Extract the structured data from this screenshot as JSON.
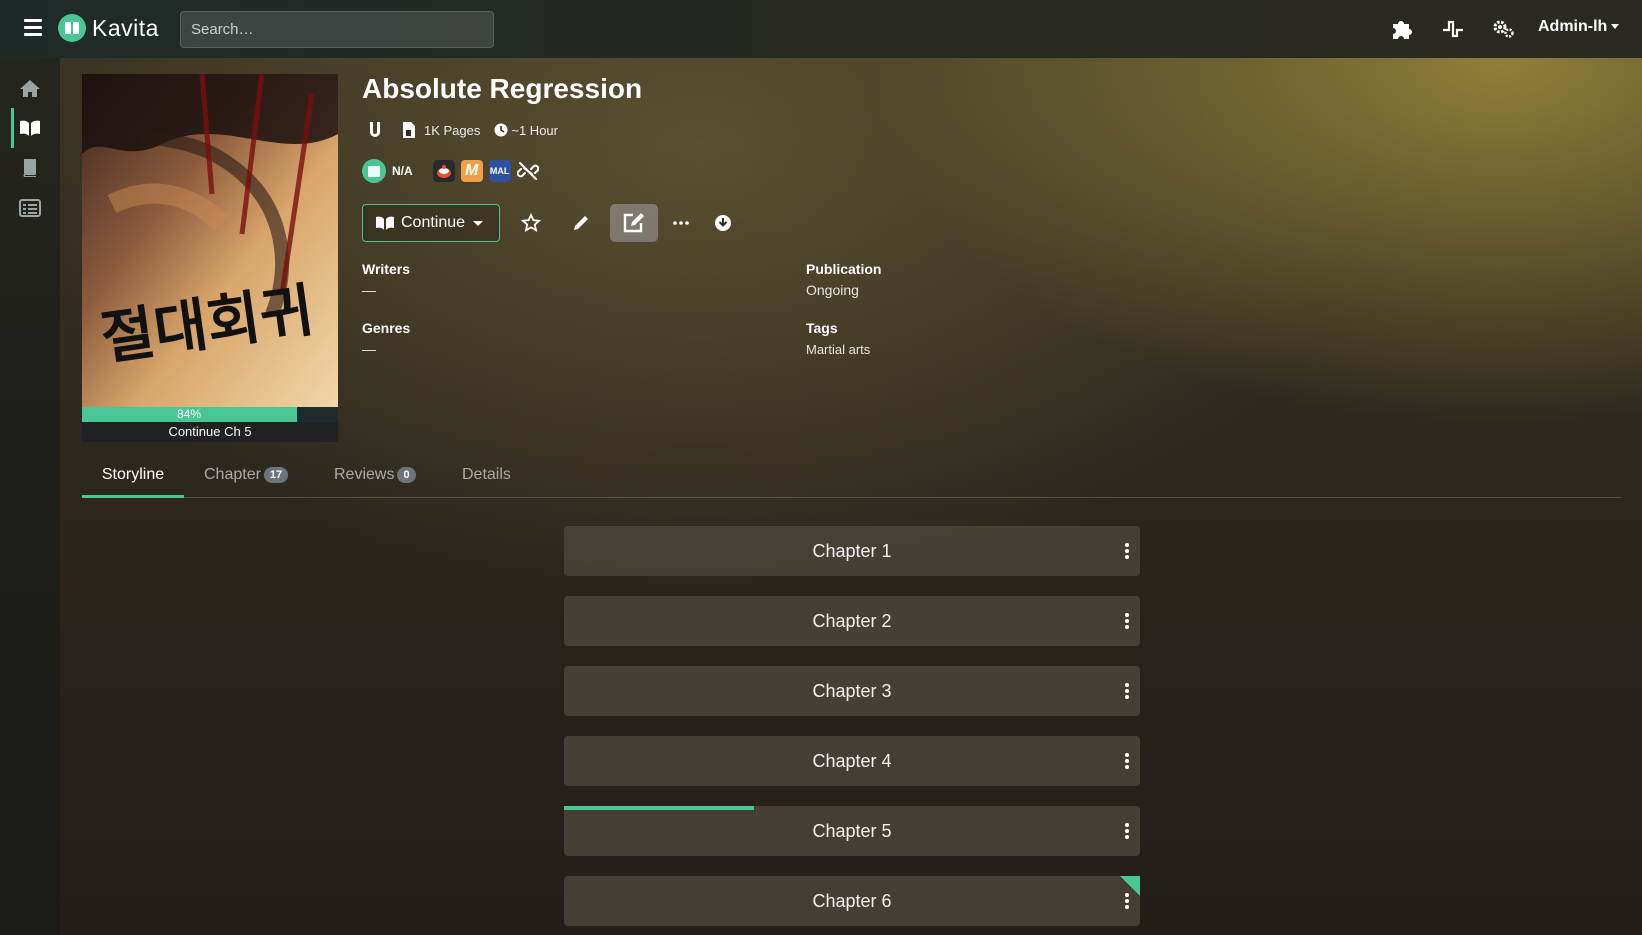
{
  "app": {
    "name": "Kavita",
    "brand_color": "#4ac694"
  },
  "navbar": {
    "search_placeholder": "Search…",
    "icons": [
      "menu-icon",
      "puzzle-icon",
      "activity-icon",
      "settings-cogs-icon"
    ],
    "user_label": "Admin-lh"
  },
  "sidenav": {
    "items": [
      {
        "name": "home",
        "icon": "home-icon",
        "active": false
      },
      {
        "name": "library",
        "icon": "book-open-icon",
        "active": true
      },
      {
        "name": "reading-list",
        "icon": "book-icon",
        "active": false
      },
      {
        "name": "collections",
        "icon": "list-icon",
        "active": false
      }
    ]
  },
  "series": {
    "title": "Absolute Regression",
    "pages": "1K Pages",
    "read_time": "~1 Hour",
    "rating": "N/A",
    "progress_percent": 84,
    "progress_label": "84%",
    "continue_chapter": "Continue Ch 5",
    "cover_text": "절대회귀"
  },
  "external_links": [
    {
      "name": "anilist",
      "color": "#e94f2c"
    },
    {
      "name": "mangaupdates",
      "label": "M",
      "color": "#f0a04b"
    },
    {
      "name": "myanimelist",
      "label": "MAL",
      "color": "#2e51a2"
    },
    {
      "name": "unlink",
      "icon": "link-broken-icon"
    }
  ],
  "actions": {
    "continue_label": "Continue",
    "icons": [
      "star-icon",
      "pencil-icon",
      "edit-icon",
      "ellipsis-icon",
      "download-icon"
    ]
  },
  "info": {
    "writers_label": "Writers",
    "writers_value": "—",
    "genres_label": "Genres",
    "genres_value": "—",
    "publication_label": "Publication",
    "publication_value": "Ongoing",
    "tags_label": "Tags",
    "tags_value": "Martial arts"
  },
  "tabs": [
    {
      "label": "Storyline",
      "active": true
    },
    {
      "label": "Chapter",
      "badge": "17"
    },
    {
      "label": "Reviews",
      "badge": "0"
    },
    {
      "label": "Details"
    }
  ],
  "chapters": [
    {
      "name": "Chapter 1",
      "progress": 0,
      "unread_corner": false
    },
    {
      "name": "Chapter 2",
      "progress": 0,
      "unread_corner": false
    },
    {
      "name": "Chapter 3",
      "progress": 0,
      "unread_corner": false
    },
    {
      "name": "Chapter 4",
      "progress": 0,
      "unread_corner": false
    },
    {
      "name": "Chapter 5",
      "progress": 0.33,
      "unread_corner": false
    },
    {
      "name": "Chapter 6",
      "progress": 0,
      "unread_corner": true
    }
  ]
}
